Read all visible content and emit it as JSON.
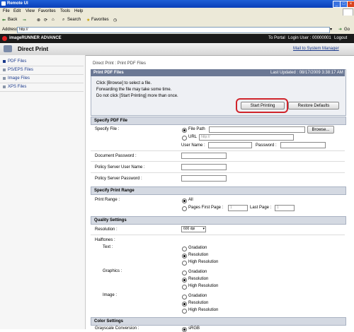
{
  "window": {
    "title": "Remote UI"
  },
  "menu": [
    "File",
    "Edit",
    "View",
    "Favorites",
    "Tools",
    "Help"
  ],
  "toolbar": {
    "back": "Back",
    "search": "Search",
    "favorites": "Favorites"
  },
  "address": {
    "label": "Address",
    "value": "http://",
    "go": "Go"
  },
  "header": {
    "brand": "imageRUNNER ADVANCE",
    "to_portal": "To Portal",
    "login_user": "Login User : 00000001",
    "logout": "Logout"
  },
  "product": {
    "title": "Direct Print",
    "mail_link": "Mail to System Manager"
  },
  "nav": [
    "PDF Files",
    "PS/EPS Files",
    "Image Files",
    "XPS Files"
  ],
  "breadcrumb": "Direct Print : Print PDF Files",
  "print_pdf": {
    "title": "Print PDF Files",
    "last_updated": "Last Updated : 08/17/2009 3:38:17 AM",
    "line1": "Click [Browse] to select a file.",
    "line2": "Forwarding the file may take some time.",
    "line3": "Do not click [Start Printing] more than once.",
    "start_btn": "Start Printing",
    "restore_btn": "Restore Defaults"
  },
  "specify_file": {
    "title": "Specify PDF File",
    "label": "Specify File :",
    "file_path": "File Path",
    "browse": "Browse...",
    "url": "URL",
    "url_placeholder": "http://",
    "user_name": "User Name :",
    "password": "Password :",
    "doc_password": "Document Password :",
    "policy_user": "Policy Server User Name :",
    "policy_password": "Policy Server Password :"
  },
  "print_range": {
    "title": "Specify Print Range",
    "label": "Print Range :",
    "all": "All",
    "pages": "Pages First Page :",
    "first_value": "1",
    "last": "Last Page :",
    "last_value": "1"
  },
  "quality": {
    "title": "Quality Settings",
    "resolution_label": "Resolution :",
    "resolution_value": "600 dpi",
    "halftones": "Halftones :",
    "text": "Text :",
    "graphics": "Graphics :",
    "image": "Image :",
    "opt_gradation": "Gradation",
    "opt_resolution": "Resolution",
    "opt_high": "High Resolution"
  },
  "color": {
    "title": "Color Settings",
    "grayscale": "Grayscale Conversion :",
    "grayscale_value": "sRGB"
  }
}
